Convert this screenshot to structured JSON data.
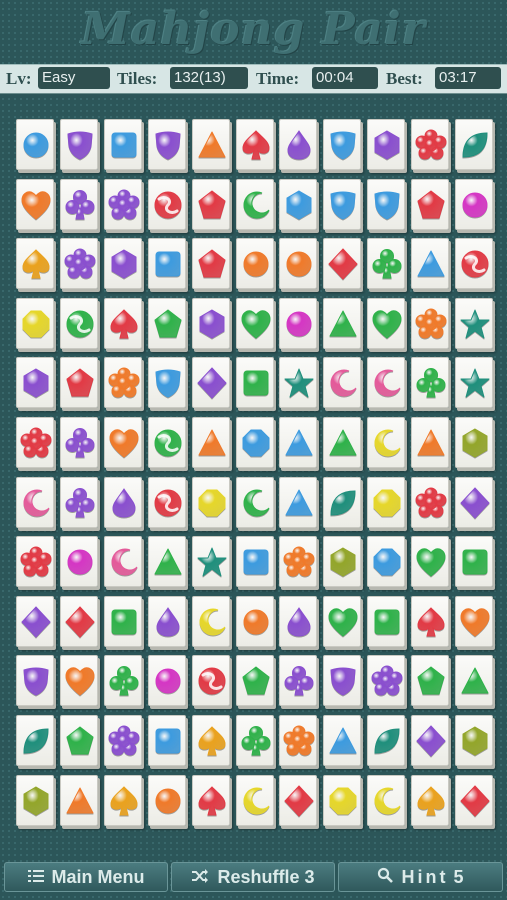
{
  "app": {
    "title": "Mahjong Pair"
  },
  "status": {
    "level_label": "Lv:",
    "level_value": "Easy",
    "tiles_label": "Tiles:",
    "tiles_value": "132(13)",
    "time_label": "Time:",
    "time_value": "00:04",
    "best_label": "Best:",
    "best_value": "03:17"
  },
  "buttons": {
    "menu_label": "Main Menu",
    "menu_icon": "list-icon",
    "reshuffle_label": "Reshuffle",
    "reshuffle_count": "3",
    "reshuffle_icon": "shuffle-icon",
    "hint_label": "Hint",
    "hint_count": "5",
    "hint_icon": "magnifier-icon"
  },
  "board": {
    "columns": 11,
    "rows": [
      [
        "circle-blue",
        "shield-purple",
        "square-blue",
        "shield-purple",
        "triangle-orange",
        "spade-red",
        "drop-purple",
        "shield-blue",
        "hexagon-purple",
        "flower-red",
        "leaf-teal"
      ],
      [
        "heart-orange",
        "club-purple",
        "flower-purple",
        "swirl-red",
        "pentagon-red",
        "moon-green",
        "hexagon-blue",
        "shield-blue",
        "shield-blue",
        "pentagon-red",
        "circle-magenta"
      ],
      [
        "spade-gold",
        "flower-purple",
        "hexagon-purple",
        "square-blue",
        "pentagon-red",
        "circle-orange",
        "circle-orange",
        "diamond-red",
        "club-green",
        "triangle-blue",
        "swirl-red"
      ],
      [
        "octagon-yellow",
        "swirl-green",
        "spade-red",
        "pentagon-green",
        "hexagon-purple",
        "heart-green",
        "circle-magenta",
        "triangle-green",
        "heart-green",
        "flower-orange",
        "star-teal"
      ],
      [
        "hexagon-purple",
        "pentagon-red",
        "flower-orange",
        "shield-blue",
        "diamond-purple",
        "square-green",
        "star-teal",
        "moon-pink",
        "moon-pink",
        "club-green",
        "star-teal"
      ],
      [
        "flower-red",
        "club-purple",
        "heart-orange",
        "swirl-green",
        "triangle-orange",
        "octagon-blue",
        "triangle-blue",
        "triangle-green",
        "moon-yellow",
        "triangle-orange",
        "hexagon-olive"
      ],
      [
        "moon-pink",
        "club-purple",
        "drop-purple",
        "swirl-red",
        "octagon-yellow",
        "moon-green",
        "triangle-blue",
        "leaf-teal",
        "octagon-yellow",
        "flower-red",
        "diamond-purple"
      ],
      [
        "flower-red",
        "circle-magenta",
        "moon-pink",
        "triangle-green",
        "star-teal",
        "square-blue",
        "flower-orange",
        "hexagon-olive",
        "octagon-blue",
        "heart-green",
        "square-green"
      ],
      [
        "diamond-purple",
        "diamond-red",
        "square-green",
        "drop-purple",
        "moon-yellow",
        "circle-orange",
        "drop-purple",
        "heart-green",
        "square-green",
        "spade-red",
        "heart-orange"
      ],
      [
        "shield-purple",
        "heart-orange",
        "club-green",
        "circle-magenta",
        "swirl-red",
        "pentagon-green",
        "club-purple",
        "shield-purple",
        "flower-purple",
        "pentagon-green",
        "triangle-green"
      ],
      [
        "leaf-teal",
        "pentagon-green",
        "flower-purple",
        "square-blue",
        "spade-gold",
        "club-green",
        "flower-orange",
        "triangle-blue",
        "leaf-teal",
        "diamond-purple",
        "hexagon-olive"
      ],
      [
        "hexagon-olive",
        "triangle-orange",
        "spade-gold",
        "circle-orange",
        "spade-red",
        "moon-yellow",
        "diamond-red",
        "octagon-yellow",
        "moon-yellow",
        "spade-gold",
        "diamond-red"
      ]
    ]
  },
  "colors": {
    "red": "#e23a45",
    "orange": "#f07a2a",
    "gold": "#eaa21e",
    "yellow": "#e6d72a",
    "green": "#2fb24a",
    "teal": "#1f8f7c",
    "blue": "#3d9bdf",
    "purple": "#8a4fcf",
    "magenta": "#d536c4",
    "pink": "#e45a9a",
    "olive": "#93a62a"
  }
}
